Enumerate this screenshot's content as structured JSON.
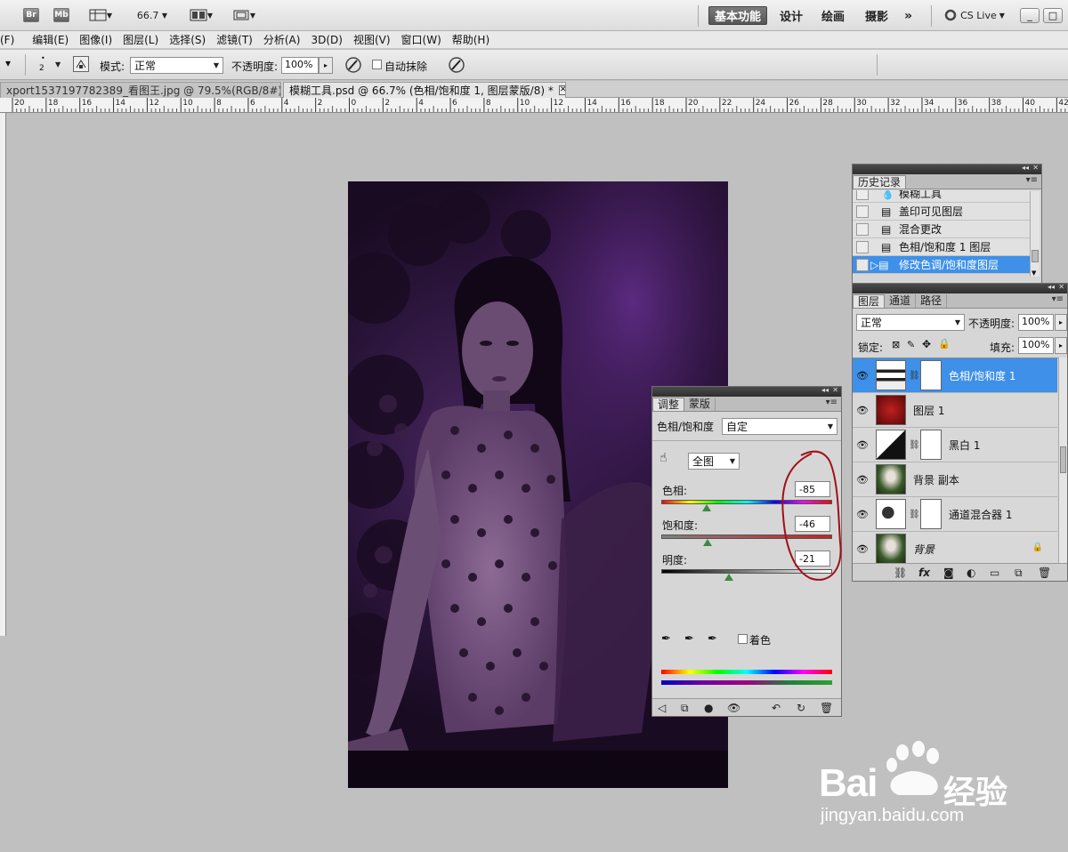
{
  "appbar": {
    "br": "Br",
    "mb": "Mb",
    "zoom": "66.7",
    "workspaces": [
      "基本功能",
      "设计",
      "绘画",
      "摄影"
    ],
    "more": "»",
    "cslive": "CS Live",
    "win_min": "_",
    "win_max": "□"
  },
  "menu": [
    "(F)",
    "编辑(E)",
    "图像(I)",
    "图层(L)",
    "选择(S)",
    "滤镜(T)",
    "分析(A)",
    "3D(D)",
    "视图(V)",
    "窗口(W)",
    "帮助(H)"
  ],
  "options": {
    "brush_size": "2",
    "mode_label": "模式:",
    "mode_value": "正常",
    "opacity_label": "不透明度:",
    "opacity_value": "100%",
    "auto_erase_label": "自动抹除"
  },
  "tabs": [
    {
      "label": "xport1537197782389_看图王.jpg @ 79.5%(RGB/8#) *",
      "close": "✕"
    },
    {
      "label": "模糊工具.psd @ 66.7% (色相/饱和度 1, 图层蒙版/8) *",
      "close": "✕"
    }
  ],
  "ruler_labels": [
    "20",
    "18",
    "16",
    "14",
    "12",
    "10",
    "8",
    "6",
    "4",
    "2",
    "0",
    "2",
    "4",
    "6",
    "8",
    "10",
    "12",
    "14",
    "16",
    "18",
    "20",
    "22",
    "24",
    "26",
    "28",
    "30",
    "32",
    "34",
    "36",
    "38",
    "40",
    "42"
  ],
  "history": {
    "tab": "历史记录",
    "items": [
      "模糊工具",
      "盖印可见图层",
      "混合更改",
      "色相/饱和度 1 图层",
      "修改色调/饱和度图层"
    ],
    "selected_index": 4
  },
  "layers": {
    "tabs": [
      "图层",
      "通道",
      "路径"
    ],
    "blend_mode": "正常",
    "opacity_label": "不透明度:",
    "opacity_value": "100%",
    "lock_label": "锁定:",
    "fill_label": "填充:",
    "fill_value": "100%",
    "items": [
      "色相/饱和度 1",
      "图层 1",
      "黑白 1",
      "背景 副本",
      "通道混合器 1",
      "背景"
    ],
    "selected_index": 0
  },
  "adjust": {
    "tabs": [
      "调整",
      "蒙版"
    ],
    "title": "色相/饱和度",
    "preset": "自定",
    "channel": "全图",
    "hue_label": "色相:",
    "hue_value": "-85",
    "sat_label": "饱和度:",
    "sat_value": "-46",
    "light_label": "明度:",
    "light_value": "-21",
    "colorize_label": "着色",
    "hue_pos": 0.264,
    "sat_pos": 0.27,
    "light_pos": 0.395
  },
  "watermark": {
    "brand": "Bai",
    "brand_suffix": "经验",
    "url": "jingyan.baidu.com"
  },
  "colors": {
    "accent": "#3e90e8",
    "annotation": "#a0101a",
    "canvas": "#2e1740"
  }
}
